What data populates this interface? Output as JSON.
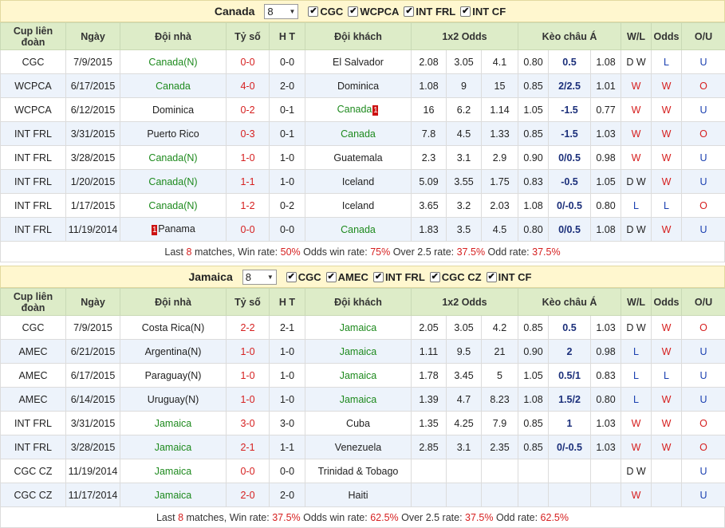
{
  "headers": [
    "Cup liên đoàn",
    "Ngày",
    "Đội nhà",
    "Tỷ số",
    "H T",
    "Đội khách",
    "1x2 Odds",
    "Kèo châu Á",
    "W/L",
    "Odds",
    "O/U"
  ],
  "canada": {
    "title": "Canada",
    "select_value": "8",
    "filters": [
      "CGC",
      "WCPCA",
      "INT FRL",
      "INT CF"
    ],
    "rows": [
      {
        "cup": "CGC",
        "date": "7/9/2015",
        "home": "Canada(N)",
        "score": "0-0",
        "ht": "0-0",
        "away": "El Salvador",
        "o1": "2.08",
        "ox": "3.05",
        "o2": "4.1",
        "h1": "0.80",
        "hl": "0.5",
        "h2": "1.08",
        "wl": "D W",
        "odds": "L",
        "ou": "U"
      },
      {
        "cup": "WCPCA",
        "date": "6/17/2015",
        "home": "Canada",
        "score": "4-0",
        "ht": "2-0",
        "away": "Dominica",
        "o1": "1.08",
        "ox": "9",
        "o2": "15",
        "h1": "0.85",
        "hl": "2/2.5",
        "h2": "1.01",
        "wl": "W",
        "odds": "W",
        "ou": "O"
      },
      {
        "cup": "WCPCA",
        "date": "6/12/2015",
        "home": "Dominica",
        "score": "0-2",
        "ht": "0-1",
        "away": "Canada",
        "away_card": "1",
        "o1": "16",
        "ox": "6.2",
        "o2": "1.14",
        "h1": "1.05",
        "hl": "-1.5",
        "h2": "0.77",
        "wl": "W",
        "odds": "W",
        "ou": "U"
      },
      {
        "cup": "INT FRL",
        "date": "3/31/2015",
        "home": "Puerto Rico",
        "score": "0-3",
        "ht": "0-1",
        "away": "Canada",
        "o1": "7.8",
        "ox": "4.5",
        "o2": "1.33",
        "h1": "0.85",
        "hl": "-1.5",
        "h2": "1.03",
        "wl": "W",
        "odds": "W",
        "ou": "O"
      },
      {
        "cup": "INT FRL",
        "date": "3/28/2015",
        "home": "Canada(N)",
        "score": "1-0",
        "ht": "1-0",
        "away": "Guatemala",
        "o1": "2.3",
        "ox": "3.1",
        "o2": "2.9",
        "h1": "0.90",
        "hl": "0/0.5",
        "h2": "0.98",
        "wl": "W",
        "odds": "W",
        "ou": "U"
      },
      {
        "cup": "INT FRL",
        "date": "1/20/2015",
        "home": "Canada(N)",
        "score": "1-1",
        "ht": "1-0",
        "away": "Iceland",
        "o1": "5.09",
        "ox": "3.55",
        "o2": "1.75",
        "h1": "0.83",
        "hl": "-0.5",
        "h2": "1.05",
        "wl": "D W",
        "odds": "W",
        "ou": "U"
      },
      {
        "cup": "INT FRL",
        "date": "1/17/2015",
        "home": "Canada(N)",
        "score": "1-2",
        "ht": "0-2",
        "away": "Iceland",
        "o1": "3.65",
        "ox": "3.2",
        "o2": "2.03",
        "h1": "1.08",
        "hl": "0/-0.5",
        "h2": "0.80",
        "wl": "L",
        "odds": "L",
        "ou": "O"
      },
      {
        "cup": "INT FRL",
        "date": "11/19/2014",
        "home": "Panama",
        "home_card": "1",
        "score": "0-0",
        "ht": "0-0",
        "away": "Canada",
        "o1": "1.83",
        "ox": "3.5",
        "o2": "4.5",
        "h1": "0.80",
        "hl": "0/0.5",
        "h2": "1.08",
        "wl": "D W",
        "odds": "W",
        "ou": "U"
      }
    ],
    "summary": {
      "p1": "Last ",
      "n": "8",
      "p2": " matches, Win rate: ",
      "win": "50%",
      "p3": " Odds win rate: ",
      "odds": "75%",
      "p4": " Over 2.5 rate: ",
      "over": "37.5%",
      "p5": " Odd rate: ",
      "odd": "37.5%"
    }
  },
  "jamaica": {
    "title": "Jamaica",
    "select_value": "8",
    "filters": [
      "CGC",
      "AMEC",
      "INT FRL",
      "CGC CZ",
      "INT CF"
    ],
    "rows": [
      {
        "cup": "CGC",
        "date": "7/9/2015",
        "home": "Costa Rica(N)",
        "score": "2-2",
        "ht": "2-1",
        "away": "Jamaica",
        "o1": "2.05",
        "ox": "3.05",
        "o2": "4.2",
        "h1": "0.85",
        "hl": "0.5",
        "h2": "1.03",
        "wl": "D W",
        "odds": "W",
        "ou": "O"
      },
      {
        "cup": "AMEC",
        "date": "6/21/2015",
        "home": "Argentina(N)",
        "score": "1-0",
        "ht": "1-0",
        "away": "Jamaica",
        "o1": "1.11",
        "ox": "9.5",
        "o2": "21",
        "h1": "0.90",
        "hl": "2",
        "h2": "0.98",
        "wl": "L",
        "odds": "W",
        "ou": "U"
      },
      {
        "cup": "AMEC",
        "date": "6/17/2015",
        "home": "Paraguay(N)",
        "score": "1-0",
        "ht": "1-0",
        "away": "Jamaica",
        "o1": "1.78",
        "ox": "3.45",
        "o2": "5",
        "h1": "1.05",
        "hl": "0.5/1",
        "h2": "0.83",
        "wl": "L",
        "odds": "L",
        "ou": "U"
      },
      {
        "cup": "AMEC",
        "date": "6/14/2015",
        "home": "Uruguay(N)",
        "score": "1-0",
        "ht": "1-0",
        "away": "Jamaica",
        "o1": "1.39",
        "ox": "4.7",
        "o2": "8.23",
        "h1": "1.08",
        "hl": "1.5/2",
        "h2": "0.80",
        "wl": "L",
        "odds": "W",
        "ou": "U"
      },
      {
        "cup": "INT FRL",
        "date": "3/31/2015",
        "home": "Jamaica",
        "score": "3-0",
        "ht": "3-0",
        "away": "Cuba",
        "o1": "1.35",
        "ox": "4.25",
        "o2": "7.9",
        "h1": "0.85",
        "hl": "1",
        "h2": "1.03",
        "wl": "W",
        "odds": "W",
        "ou": "O"
      },
      {
        "cup": "INT FRL",
        "date": "3/28/2015",
        "home": "Jamaica",
        "score": "2-1",
        "ht": "1-1",
        "away": "Venezuela",
        "o1": "2.85",
        "ox": "3.1",
        "o2": "2.35",
        "h1": "0.85",
        "hl": "0/-0.5",
        "h2": "1.03",
        "wl": "W",
        "odds": "W",
        "ou": "O"
      },
      {
        "cup": "CGC CZ",
        "date": "11/19/2014",
        "home": "Jamaica",
        "score": "0-0",
        "ht": "0-0",
        "away": "Trinidad & Tobago",
        "o1": "",
        "ox": "",
        "o2": "",
        "h1": "",
        "hl": "",
        "h2": "",
        "wl": "D W",
        "odds": "",
        "ou": "U"
      },
      {
        "cup": "CGC CZ",
        "date": "11/17/2014",
        "home": "Jamaica",
        "score": "2-0",
        "ht": "2-0",
        "away": "Haiti",
        "o1": "",
        "ox": "",
        "o2": "",
        "h1": "",
        "hl": "",
        "h2": "",
        "wl": "W",
        "odds": "",
        "ou": "U"
      }
    ],
    "summary": {
      "p1": "Last ",
      "n": "8",
      "p2": " matches, Win rate: ",
      "win": "37.5%",
      "p3": " Odds win rate: ",
      "odds": "62.5%",
      "p4": " Over 2.5 rate: ",
      "over": "37.5%",
      "p5": " Odd rate: ",
      "odd": "62.5%"
    }
  },
  "colors": {
    "green": "#1e8a1e",
    "red": "#d62020",
    "navy": "#1b2f7a",
    "header_bg": "#ddecc8",
    "section_bg": "#fff7cf",
    "alt_row": "#edf3fb"
  },
  "icons": {
    "checkbox": "checkbox-checked-icon",
    "dropdown": "chevron-down-icon",
    "red_card": "red-card-icon"
  }
}
